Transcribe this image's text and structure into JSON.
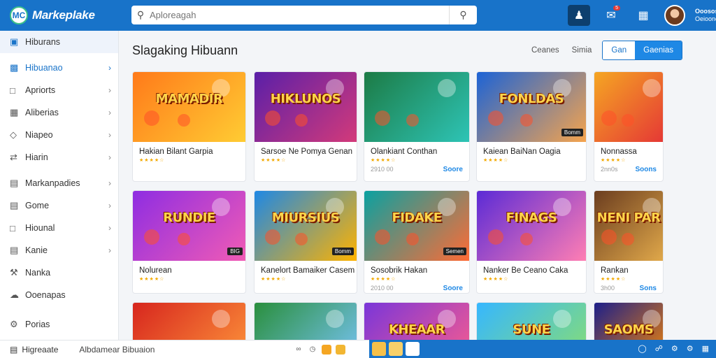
{
  "app": {
    "name": "Markeplake",
    "logo_letters": "MC"
  },
  "search": {
    "placeholder": "Aploreagah"
  },
  "header": {
    "notif_count": "5",
    "user_line1": "Ooosos",
    "user_line2": "Oeioone"
  },
  "sidebar": {
    "items": [
      {
        "label": "Hiburans",
        "icon": "store-icon"
      },
      {
        "label": "Hibuanao",
        "icon": "category-icon"
      },
      {
        "label": "Apriorts",
        "icon": "folder-icon"
      },
      {
        "label": "Aliberias",
        "icon": "grid-icon"
      },
      {
        "label": "Niapeo",
        "icon": "tag-icon"
      },
      {
        "label": "Hiarin",
        "icon": "arrows-icon"
      },
      {
        "label": "Markanpadies",
        "icon": "market-icon"
      },
      {
        "label": "Gome",
        "icon": "doc-icon"
      },
      {
        "label": "Hiounal",
        "icon": "chat-icon"
      },
      {
        "label": "Kanie",
        "icon": "calendar-icon"
      },
      {
        "label": "Nanka",
        "icon": "tool-icon"
      },
      {
        "label": "Ooenapas",
        "icon": "cloud-icon"
      },
      {
        "label": "Porias",
        "icon": "gear-icon"
      }
    ]
  },
  "main": {
    "title": "Slagaking Hibuann",
    "filters": {
      "a": "Ceanes",
      "b": "Simia",
      "c": "Gan",
      "d": "Gaenias"
    }
  },
  "cards": [
    {
      "thumb_title": "MAMADIR",
      "name": "Hakian Bilant Garpia",
      "price": "",
      "action": ""
    },
    {
      "thumb_title": "HIKLUNOS",
      "name": "Sarsoe Ne Pomya Genan",
      "price": "",
      "action": ""
    },
    {
      "thumb_title": "",
      "name": "Olankiant Conthan",
      "price": "2910 00",
      "action": "Soore"
    },
    {
      "thumb_title": "FONLDAS",
      "tag": "Bomm",
      "name": "Kaiean BaiNan Oagia",
      "price": "",
      "action": ""
    },
    {
      "thumb_title": "",
      "name": "Nonnassa",
      "price": "2nn0s",
      "action": "Soons"
    },
    {
      "thumb_title": "RUNDIE",
      "tag": "BIG",
      "name": "Nolurean",
      "price": "",
      "action": ""
    },
    {
      "thumb_title": "MIURSIUS",
      "tag": "Bomm",
      "name": "Kanelort Bamaiker Casem",
      "price": "",
      "action": ""
    },
    {
      "thumb_title": "FIDAKE",
      "tag": "Semen",
      "name": "Sosobrik Hakan",
      "price": "2010 00",
      "action": "Soore"
    },
    {
      "thumb_title": "FINAGS",
      "name": "Nanker Be Ceano Caka",
      "price": "",
      "action": ""
    },
    {
      "thumb_title": "NENI PAR",
      "name": "Rankan",
      "price": "3h00",
      "action": "Sons"
    },
    {
      "thumb_title": "",
      "name": "",
      "price": "",
      "action": ""
    },
    {
      "thumb_title": "",
      "name": "",
      "price": "",
      "action": ""
    },
    {
      "thumb_title": "KHEAAR",
      "name": "",
      "price": "",
      "action": ""
    },
    {
      "thumb_title": "SUNE",
      "name": "",
      "price": "",
      "action": ""
    },
    {
      "thumb_title": "SAOMS",
      "name": "",
      "price": "",
      "action": ""
    }
  ],
  "status": {
    "left": "Higreaate",
    "path": "Albdamear Bibuaion"
  },
  "colors": {
    "accent": "#1873c9",
    "button": "#1e88e5",
    "star": "#f2a900"
  }
}
